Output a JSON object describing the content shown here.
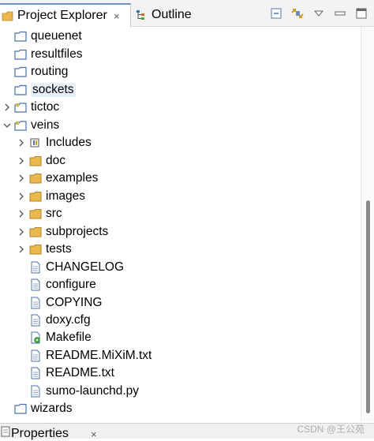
{
  "tabs": {
    "project_explorer": {
      "label": "Project Explorer",
      "close": "×"
    },
    "outline": {
      "label": "Outline"
    }
  },
  "tree": {
    "rows": [
      {
        "label": "queuenet",
        "icon": "folder"
      },
      {
        "label": "resultfiles",
        "icon": "folder"
      },
      {
        "label": "routing",
        "icon": "folder"
      },
      {
        "label": "sockets",
        "icon": "folder",
        "selected": true
      },
      {
        "label": "tictoc",
        "icon": "project-folder",
        "twisty": "collapsed"
      },
      {
        "label": "veins",
        "icon": "project-folder",
        "twisty": "expanded"
      },
      {
        "label": "Includes",
        "icon": "includes",
        "twisty": "collapsed"
      },
      {
        "label": "doc",
        "icon": "folder",
        "twisty": "collapsed"
      },
      {
        "label": "examples",
        "icon": "folder",
        "twisty": "collapsed"
      },
      {
        "label": "images",
        "icon": "folder",
        "twisty": "collapsed"
      },
      {
        "label": "src",
        "icon": "folder",
        "twisty": "collapsed"
      },
      {
        "label": "subprojects",
        "icon": "folder",
        "twisty": "collapsed"
      },
      {
        "label": "tests",
        "icon": "folder",
        "twisty": "collapsed"
      },
      {
        "label": "CHANGELOG",
        "icon": "file"
      },
      {
        "label": "configure",
        "icon": "file"
      },
      {
        "label": "COPYING",
        "icon": "file"
      },
      {
        "label": "doxy.cfg",
        "icon": "file"
      },
      {
        "label": "Makefile",
        "icon": "makefile"
      },
      {
        "label": "README.MiXiM.txt",
        "icon": "file"
      },
      {
        "label": "README.txt",
        "icon": "file"
      },
      {
        "label": "sumo-launchd.py",
        "icon": "file"
      },
      {
        "label": "wizards",
        "icon": "folder"
      }
    ]
  },
  "bottom_panel": {
    "label": "Properties",
    "close": "×"
  },
  "watermark": "CSDN @王公苑",
  "colors": {
    "accent": "#6b8fc0",
    "folder": "#e9b94e",
    "selection": "#e8f0fb"
  },
  "toolbar_icons": [
    "collapse-all-icon",
    "link-with-editor-icon",
    "view-menu-icon",
    "minimize-icon",
    "maximize-icon"
  ]
}
